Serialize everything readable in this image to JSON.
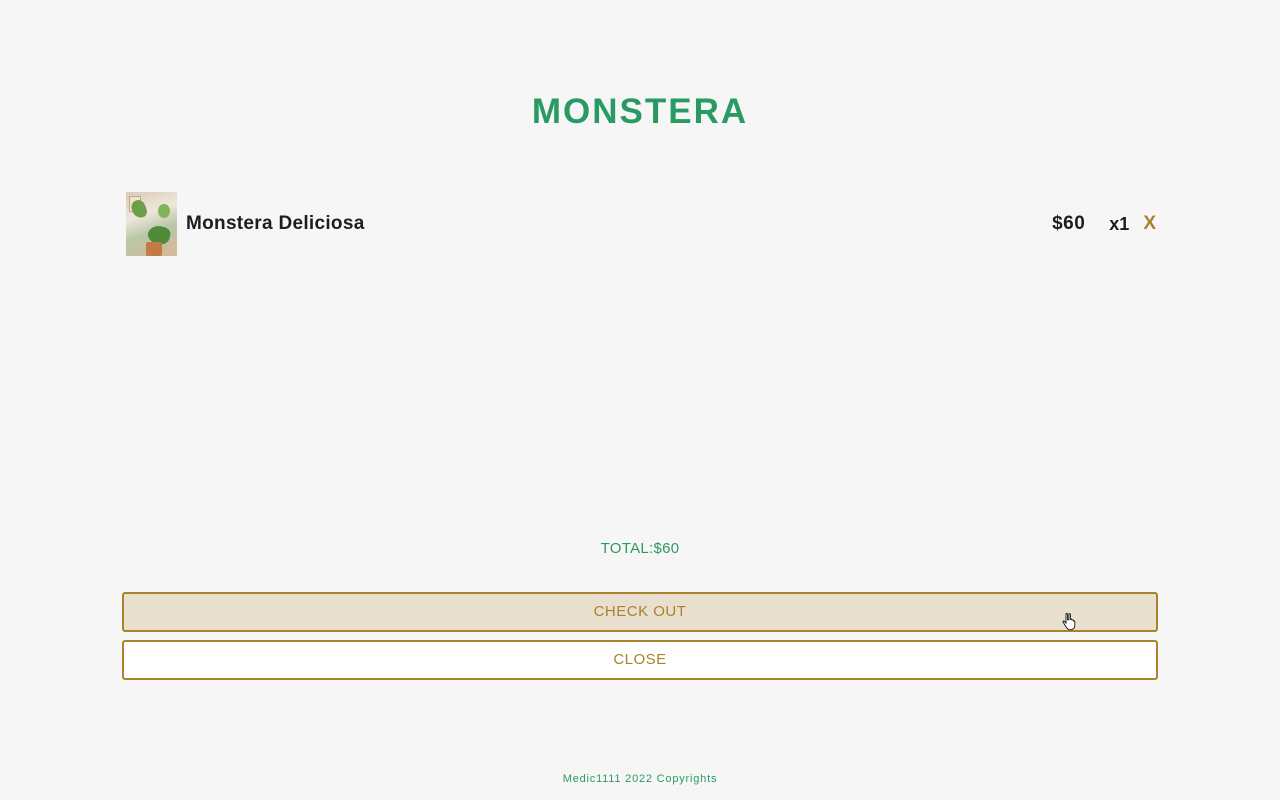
{
  "header": {
    "brand": "MONSTERA"
  },
  "cart": {
    "items": [
      {
        "image_icon": "plant-photo",
        "name": "Monstera Deliciosa",
        "price": "$60",
        "quantity": "x1",
        "remove_label": "X"
      }
    ],
    "total_label": "TOTAL:$60"
  },
  "actions": {
    "checkout_label": "CHECK OUT",
    "close_label": "CLOSE"
  },
  "footer": {
    "text": "Medic1111 2022 Copyrights"
  },
  "colors": {
    "brand_green": "#2a9a63",
    "accent_gold": "#a8832b",
    "checkout_bg": "#e8dfcf",
    "page_bg": "#f6f6f6"
  }
}
